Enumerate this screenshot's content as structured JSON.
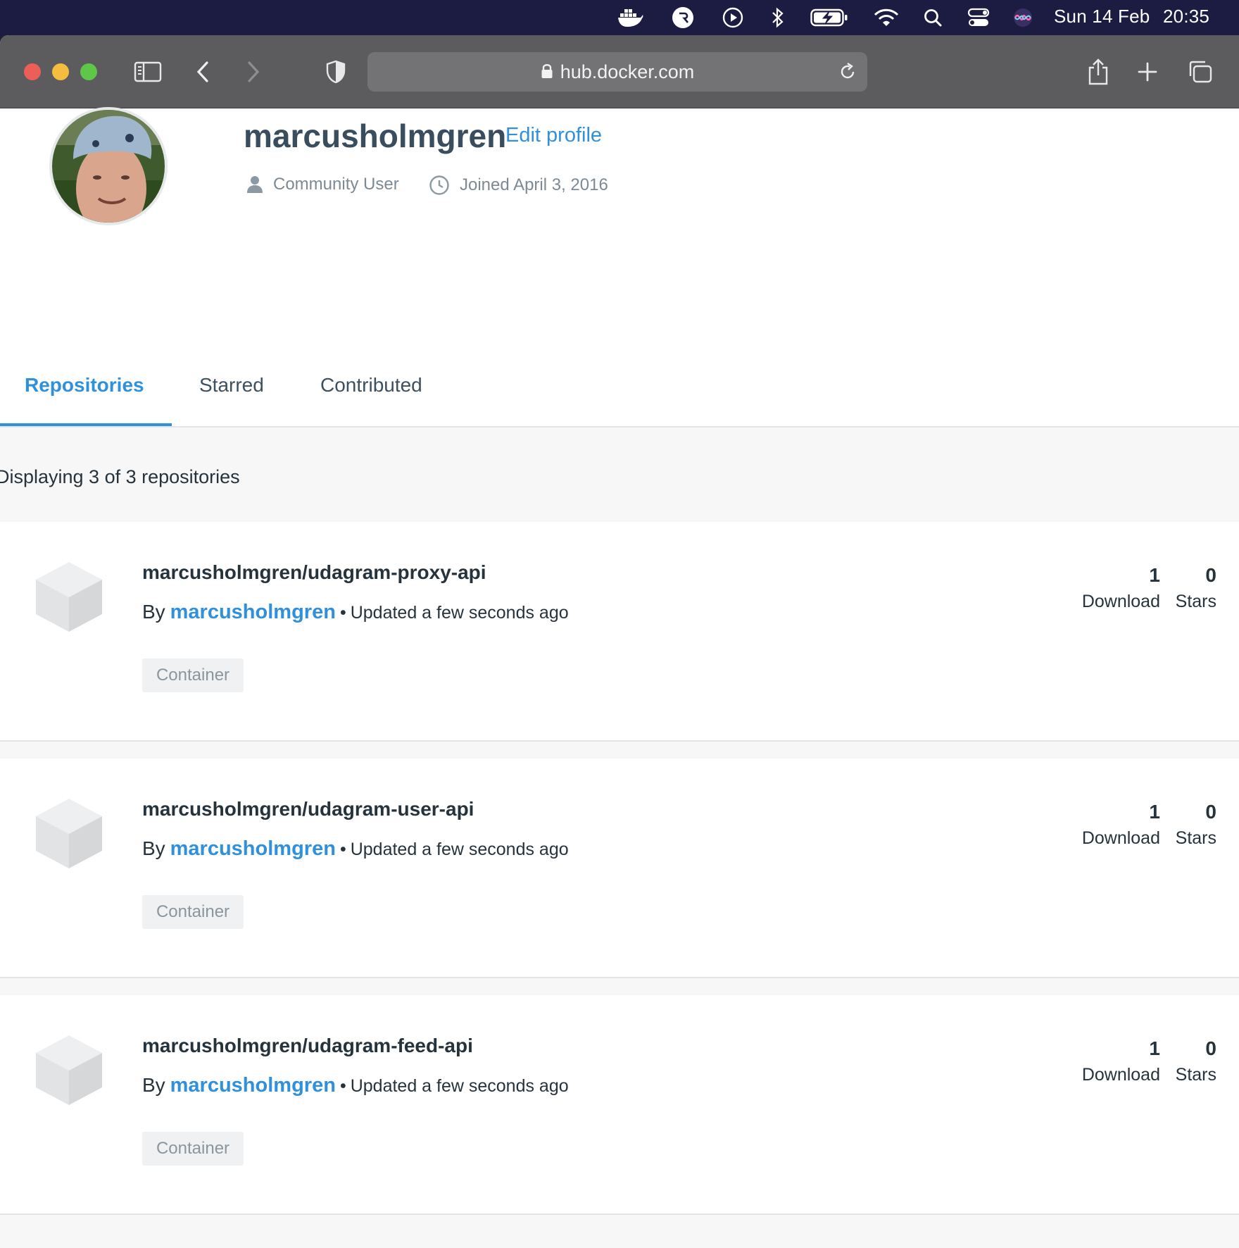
{
  "menubar": {
    "icons": [
      "docker-icon",
      "r-app-icon",
      "play-circle-icon",
      "bluetooth-icon",
      "battery-icon",
      "wifi-icon",
      "spotlight-search-icon",
      "control-center-icon",
      "siri-icon"
    ],
    "date": "Sun 14 Feb",
    "time": "20:35"
  },
  "browser": {
    "url": "hub.docker.com",
    "colors": {
      "toolbar": "#5c5c5e",
      "close": "#ec5f57",
      "minimize": "#f4bd3f",
      "zoom": "#5ec648"
    }
  },
  "profile": {
    "username": "marcusholmgren",
    "edit_label": "Edit profile",
    "role": "Community User",
    "joined": "Joined April 3, 2016"
  },
  "tabs": [
    {
      "label": "Repositories",
      "active": true
    },
    {
      "label": "Starred",
      "active": false
    },
    {
      "label": "Contributed",
      "active": false
    }
  ],
  "results_text": "Displaying 3 of 3 repositories",
  "repositories": [
    {
      "name": "marcusholmgren/udagram-proxy-api",
      "by_label": "By",
      "owner": "marcusholmgren",
      "updated": "Updated a few seconds ago",
      "badge": "Container",
      "downloads": "1",
      "downloads_label": "Download",
      "stars": "0",
      "stars_label": "Stars"
    },
    {
      "name": "marcusholmgren/udagram-user-api",
      "by_label": "By",
      "owner": "marcusholmgren",
      "updated": "Updated a few seconds ago",
      "badge": "Container",
      "downloads": "1",
      "downloads_label": "Download",
      "stars": "0",
      "stars_label": "Stars"
    },
    {
      "name": "marcusholmgren/udagram-feed-api",
      "by_label": "By",
      "owner": "marcusholmgren",
      "updated": "Updated a few seconds ago",
      "badge": "Container",
      "downloads": "1",
      "downloads_label": "Download",
      "stars": "0",
      "stars_label": "Stars"
    }
  ],
  "theme": {
    "accent": "#2f91dc",
    "text": "#26333d",
    "footer": "#0f1e3d"
  }
}
